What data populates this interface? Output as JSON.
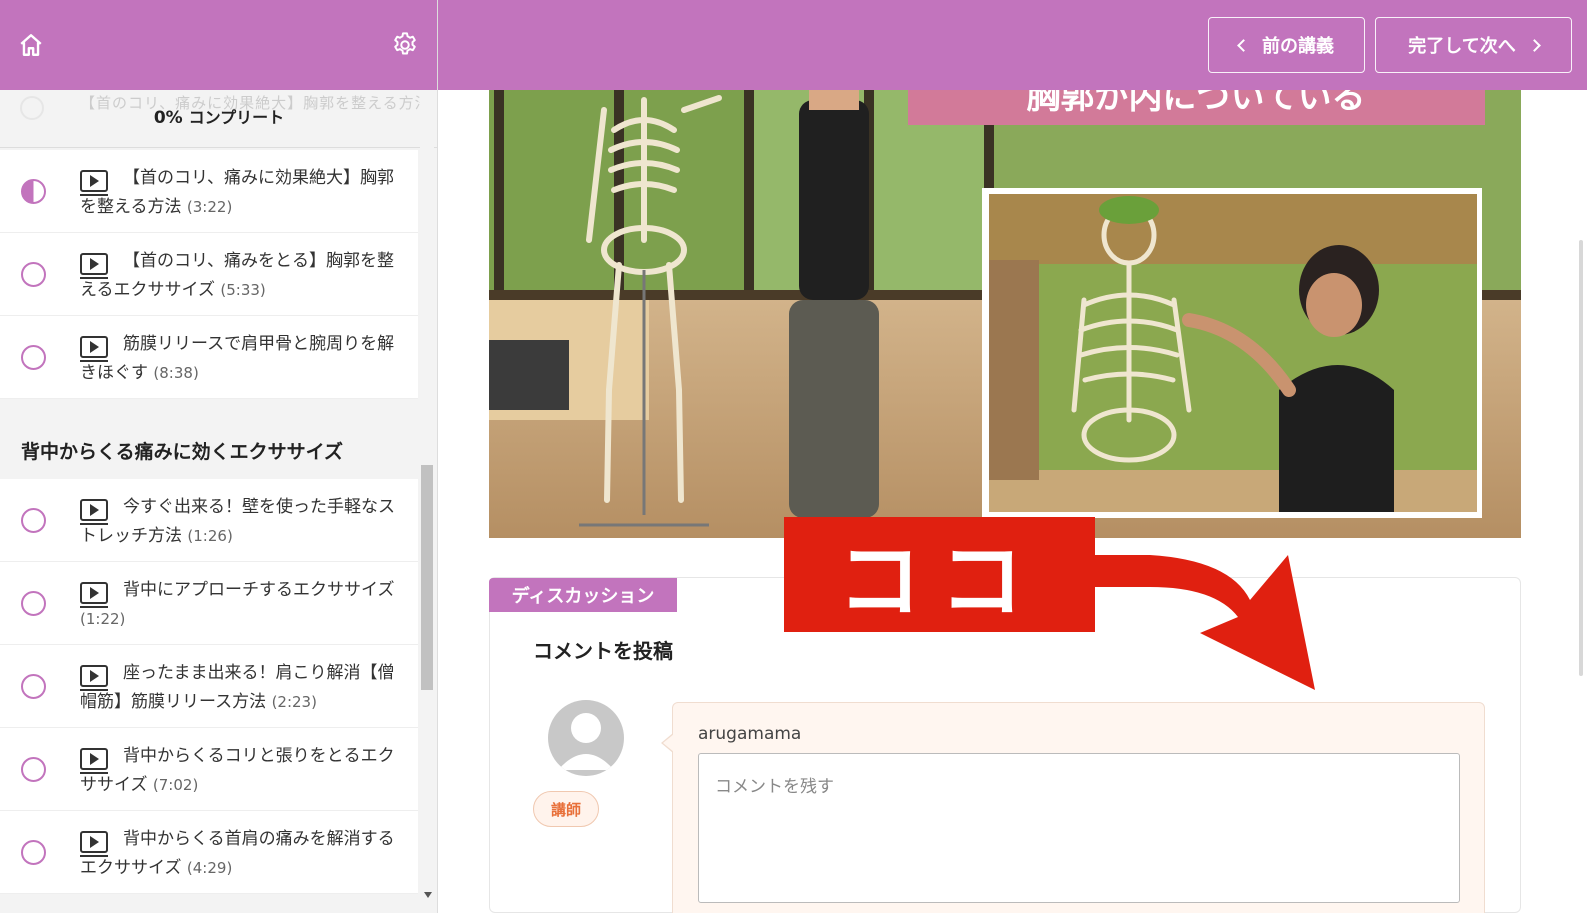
{
  "sidebar": {
    "complete": {
      "percent": "0%",
      "label": "コンプリート",
      "ghost_text": "【首のコリ、痛みに効果絶大】胸郭を整える方法"
    },
    "lessons_top": [
      {
        "title": "【首のコリ、痛みに効果絶大】胸郭を整える方法",
        "duration": "(3:22)",
        "status": "in-progress"
      },
      {
        "title": "【首のコリ、痛みをとる】胸郭を整えるエクササイズ",
        "duration": "(5:33)",
        "status": "not-started"
      },
      {
        "title": "筋膜リリースで肩甲骨と腕周りを解きほぐす",
        "duration": "(8:38)",
        "status": "not-started"
      }
    ],
    "section_title": "背中からくる痛みに効くエクササイズ",
    "lessons_bottom": [
      {
        "title": "今すぐ出来る！壁を使った手軽なストレッチ方法",
        "duration": "(1:26)",
        "status": "not-started"
      },
      {
        "title": "背中にアプローチするエクササイズ",
        "duration": "(1:22)",
        "status": "not-started"
      },
      {
        "title": "座ったまま出来る！肩こり解消【僧帽筋】筋膜リリース方法",
        "duration": "(2:23)",
        "status": "not-started"
      },
      {
        "title": "背中からくるコリと張りをとるエクササイズ",
        "duration": "(7:02)",
        "status": "not-started"
      },
      {
        "title": "背中からくる首肩の痛みを解消するエクササイズ",
        "duration": "(4:29)",
        "status": "not-started"
      }
    ]
  },
  "topbar": {
    "prev_label": "前の講義",
    "next_label": "完了して次へ"
  },
  "video": {
    "caption_fragment": "胸郭が内にづいている"
  },
  "discussion": {
    "tab_label": "ディスカッション",
    "post_title": "コメントを投稿",
    "badge": "講師",
    "username": "arugamama",
    "placeholder": "コメントを残す"
  },
  "annotation": {
    "callout_text": "ココ"
  },
  "colors": {
    "brand": "#c274bd",
    "callout": "#e02010",
    "badge_text": "#e8703a"
  }
}
